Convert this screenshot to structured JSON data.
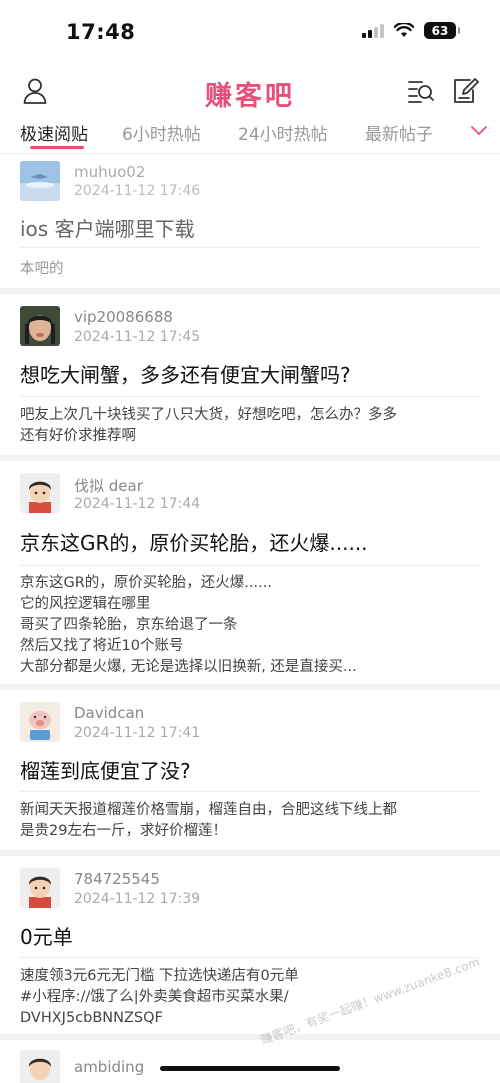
{
  "status_bar": {
    "time": "17:48",
    "battery": "63"
  },
  "header": {
    "title": "赚客吧",
    "profile_icon": "user-icon",
    "search_icon": "search-list-icon",
    "compose_icon": "compose-icon"
  },
  "tabs": [
    {
      "label": "极速阅贴",
      "active": true
    },
    {
      "label": "6小时热帖",
      "active": false
    },
    {
      "label": "24小时热帖",
      "active": false
    },
    {
      "label": "最新帖子",
      "active": false
    }
  ],
  "posts": [
    {
      "author": "muhuo02",
      "time": "2024-11-12 17:46",
      "title": "ios 客户端哪里下载",
      "excerpt": [
        "本吧的"
      ]
    },
    {
      "author": "vip20086688",
      "time": "2024-11-12 17:45",
      "title": "想吃大闸蟹，多多还有便宜大闸蟹吗?",
      "excerpt": [
        "吧友上次几十块钱买了八只大货，好想吃吧，怎么办？多多",
        "还有好价求推荐啊"
      ]
    },
    {
      "author": "伐拟 dear",
      "time": "2024-11-12 17:44",
      "title": "京东这GR的，原价买轮胎，还火爆......",
      "excerpt": [
        "京东这GR的，原价买轮胎，还火爆......",
        "它的风控逻辑在哪里",
        "哥买了四条轮胎，京东给退了一条",
        "然后又找了将近10个账号",
        "大部分都是火爆, 无论是选择以旧换新, 还是直接买..."
      ]
    },
    {
      "author": "Davidcan",
      "time": "2024-11-12 17:41",
      "title": "榴莲到底便宜了没?",
      "excerpt": [
        "新闻天天报道榴莲价格雪崩，榴莲自由，合肥这线下线上都",
        "是贵29左右一斤，求好价榴莲！"
      ]
    },
    {
      "author": "784725545",
      "time": "2024-11-12 17:39",
      "title": "0元单",
      "excerpt": [
        "速度领3元6元无门槛 下拉选快递店有0元单",
        "#小程序://饿了么|外卖美食超市买菜水果/",
        "DVHXJ5cbBNNZSQF"
      ]
    },
    {
      "author": "ambiding",
      "time": "",
      "title": "",
      "excerpt": []
    }
  ],
  "watermark": "赚客吧，有奖一起赚！www.zuanke8.com",
  "colors": {
    "accent": "#e8507a"
  }
}
